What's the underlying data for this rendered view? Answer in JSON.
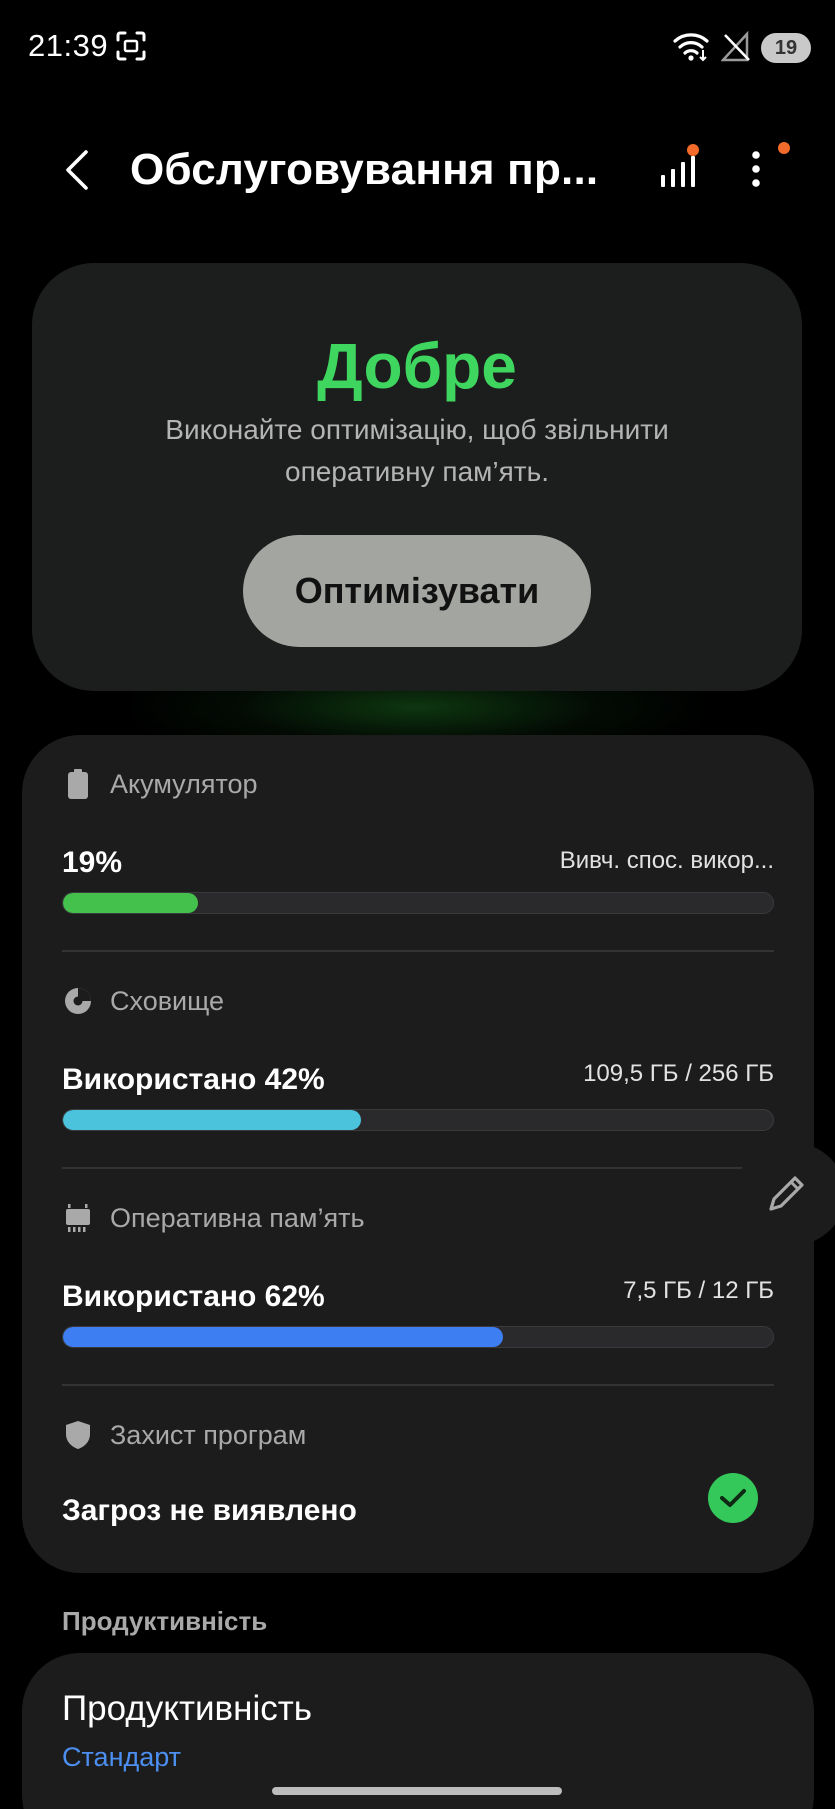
{
  "status_bar": {
    "time": "21:39",
    "battery_level": "19",
    "icons": [
      "screenshot-icon",
      "wifi-icon",
      "no-signal-icon",
      "battery-icon"
    ]
  },
  "toolbar": {
    "title": "Обслуговування пр...",
    "icons": [
      "back-icon",
      "signal-chart-icon",
      "more-vert-icon"
    ],
    "notification_color": "#f26b2a"
  },
  "hero": {
    "status": "Добре",
    "description": "Виконайте оптимізацію, щоб звільнити оперативну пам’ять.",
    "button_label": "Оптимізувати",
    "status_color": "#3fd660"
  },
  "battery": {
    "title": "Акумулятор",
    "value": "19%",
    "right_text": "Вивч. спос. викор...",
    "progress": 0.19,
    "color": "#43c14c"
  },
  "storage": {
    "title": "Сховище",
    "value": "Використано 42%",
    "right_text": "109,5 ГБ / 256 ГБ",
    "progress": 0.42,
    "color": "#4cc3dc"
  },
  "ram": {
    "title": "Оперативна пам’ять",
    "value": "Використано 62%",
    "right_text": "7,5 ГБ / 12 ГБ",
    "progress": 0.62,
    "color": "#3d7ff2"
  },
  "app_protection": {
    "title": "Захист програм",
    "value": "Загроз не виявлено",
    "check_color": "#34c759"
  },
  "performance": {
    "section_heading": "Продуктивність",
    "title": "Продуктивність",
    "subtitle": "Стандарт",
    "subtitle_color": "#4c8ff0"
  }
}
